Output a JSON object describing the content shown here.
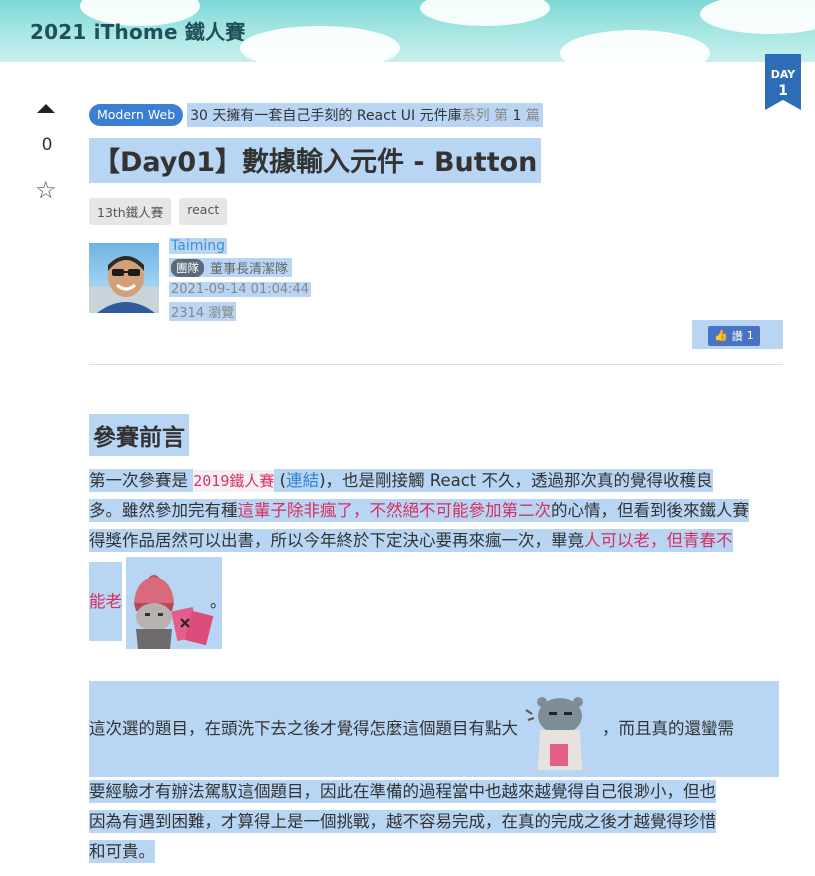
{
  "site": {
    "title": "2021 iThome 鐵人賽"
  },
  "ribbon": {
    "day_label": "DAY",
    "day_number": "1"
  },
  "vote": {
    "count": "0"
  },
  "series": {
    "category": "Modern Web",
    "name": "30 天擁有一套自己手刻的 React UI 元件庫",
    "suffix_a": "系列",
    "suffix_b": "第",
    "number": "1",
    "suffix_c": "篇"
  },
  "post": {
    "title": "【Day01】數據輸入元件 - Button",
    "tags": [
      "13th鐵人賽",
      "react"
    ]
  },
  "author": {
    "name": "Taiming",
    "team_badge": "團隊",
    "team_name": "董事長清潔隊",
    "datetime": "2021-09-14 01:04:44",
    "views": "2314 瀏覽"
  },
  "like": {
    "label": "讚",
    "count": "1"
  },
  "content": {
    "heading": "參賽前言",
    "p1": {
      "l1_a": "第一次參賽是 ",
      "l1_code": "2019鐵人賽",
      "l1_b": " (",
      "l1_link": "連結",
      "l1_c": ")，也是剛接觸 React 不久，透過那次真的覺得收穫良",
      "l2_a": "多。雖然參加完有種",
      "l2_red": "這輩子除非瘋了，不然絕不可能參加第二次",
      "l2_b": "的心情，但看到後來鐵人賽",
      "l3_a": "得獎作品居然可以出書，所以今年終於下定決心要再來瘋一次，畢竟",
      "l3_red": "人可以老，但青春不",
      "l4_red": "能老",
      "l4_end": "。"
    },
    "p2": {
      "l1_a": "這次選的題目，在頭洗下去之後才覺得怎麼這個題目有點大",
      "l1_b": "，而且真的還蠻需",
      "l2": "要經驗才有辦法駕馭這個題目，因此在準備的過程當中也越來越覺得自己很渺小，但也",
      "l3": "因為有遇到困難，才算得上是一個挑戰，越不容易完成，在真的完成之後才越覺得珍惜",
      "l4": "和可貴。"
    }
  }
}
